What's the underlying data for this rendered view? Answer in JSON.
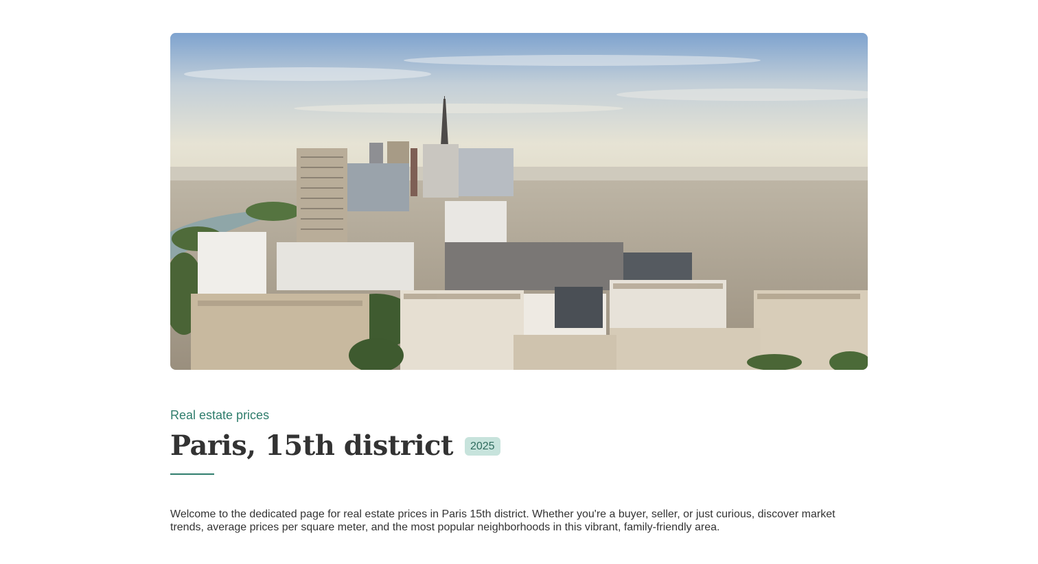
{
  "hero": {
    "alt": "Aerial view of Paris 15th district skyline with the Eiffel Tower"
  },
  "header": {
    "eyebrow": "Real estate prices",
    "title": "Paris, 15th district",
    "year_badge": "2025"
  },
  "intro": {
    "text": "Welcome to the dedicated page for real estate prices in Paris 15th district. Whether you're a buyer, seller, or just curious, discover market trends, average prices per square meter, and the most popular neighborhoods in this vibrant, family-friendly area."
  },
  "colors": {
    "accent": "#2f7d6c",
    "badge_bg": "#c7e3dc",
    "text": "#333333"
  }
}
